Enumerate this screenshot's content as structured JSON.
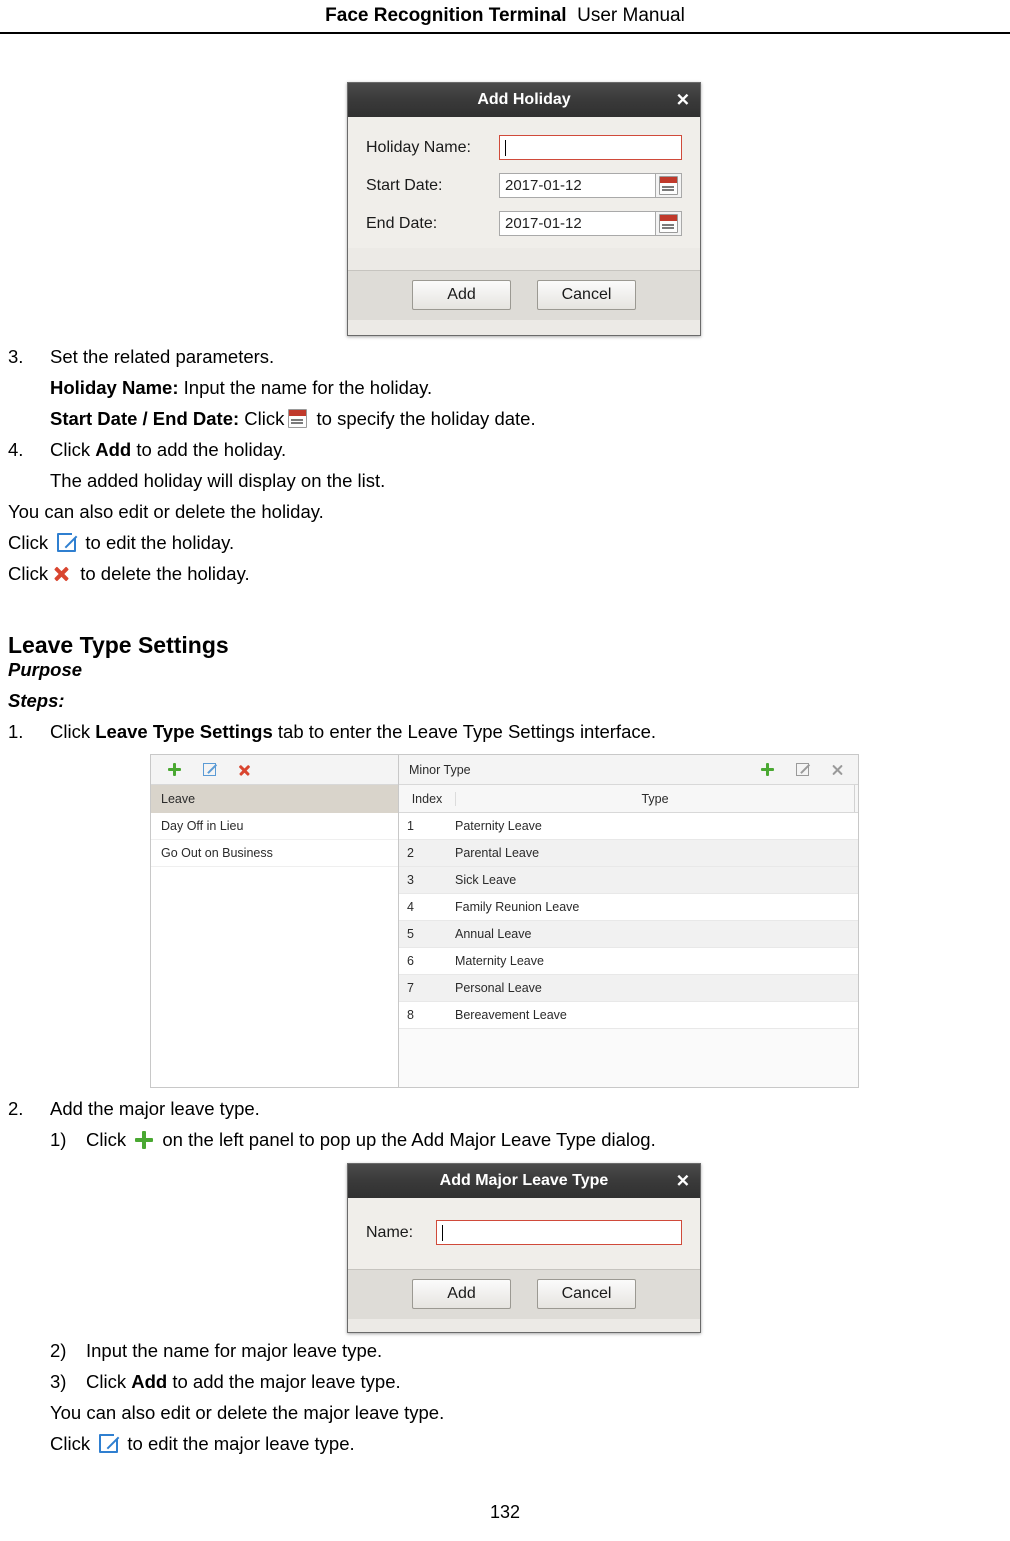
{
  "header": {
    "title_bold": "Face Recognition Terminal",
    "title_light": "User Manual"
  },
  "add_holiday_dialog": {
    "title": "Add Holiday",
    "close": "✕",
    "fields": [
      {
        "label": "Holiday Name:",
        "value": ""
      },
      {
        "label": "Start Date:",
        "value": "2017-01-12"
      },
      {
        "label": "End Date:",
        "value": "2017-01-12"
      }
    ],
    "add_button": "Add",
    "cancel_button": "Cancel"
  },
  "holiday_steps": {
    "s3_num": "3.",
    "s3_text": "Set the related parameters.",
    "holiday_name_label": "Holiday Name:",
    "holiday_name_text": " Input the name for the holiday.",
    "dates_label": "Start Date / End Date:",
    "dates_text_before": " Click",
    "dates_text_after": "to specify the holiday date.",
    "s4_num": "4.",
    "s4_click": "Click ",
    "s4_bold": "Add",
    "s4_rest": " to add the holiday.",
    "s4_sub": "The added holiday will display on the list.",
    "edit_delete_note": "You can also edit or delete the holiday.",
    "click_edit_before": "Click",
    "click_edit_after": "to edit the holiday.",
    "click_delete_before": "Click",
    "click_delete_after": "to delete the holiday."
  },
  "leave_type_section": {
    "heading": "Leave Type Settings",
    "purpose": "Purpose",
    "steps": "Steps:",
    "s1_num": "1.",
    "s1_click": "Click ",
    "s1_bold": "Leave Type Settings",
    "s1_rest": " tab to enter the Leave Type Settings interface."
  },
  "leave_panel": {
    "left_title": "Leave",
    "left_rows": [
      "Day Off in Lieu",
      "Go Out on Business"
    ],
    "right_title": "Minor Type",
    "columns": [
      "Index",
      "Type"
    ],
    "rows": [
      {
        "index": "1",
        "type": "Paternity Leave"
      },
      {
        "index": "2",
        "type": "Parental Leave"
      },
      {
        "index": "3",
        "type": "Sick Leave"
      },
      {
        "index": "4",
        "type": "Family Reunion Leave"
      },
      {
        "index": "5",
        "type": "Annual Leave"
      },
      {
        "index": "6",
        "type": "Maternity Leave"
      },
      {
        "index": "7",
        "type": "Personal Leave"
      },
      {
        "index": "8",
        "type": "Bereavement Leave"
      }
    ]
  },
  "major_steps": {
    "s2_num": "2.",
    "s2_text": "Add the major leave type.",
    "s2_1_num": "1)",
    "s2_1_before": "Click",
    "s2_1_after": "on the left panel to pop up the Add Major Leave Type dialog.",
    "s2_2_num": "2)",
    "s2_2_text": "Input the name for major leave type.",
    "s2_3_num": "3)",
    "s2_3_click": "Click ",
    "s2_3_bold": "Add",
    "s2_3_rest": " to add the major leave type.",
    "note": "You can also edit or delete the major leave type.",
    "click_edit_before": "Click",
    "click_edit_after": "to edit the major leave type."
  },
  "add_major_dialog": {
    "title": "Add Major Leave Type",
    "close": "✕",
    "name_label": "Name:",
    "name_value": "",
    "add_button": "Add",
    "cancel_button": "Cancel"
  },
  "footer": {
    "page_number": "132"
  }
}
